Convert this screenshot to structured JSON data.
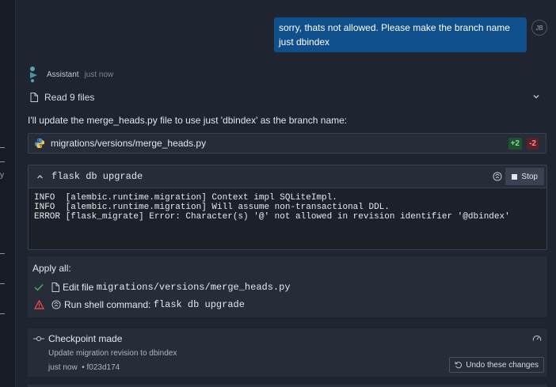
{
  "user_message": {
    "text": "sorry, thats not allowed. Please make the branch name just dbindex",
    "avatar_initials": "JB"
  },
  "assistant": {
    "name": "Assistant",
    "time": "just now",
    "read_files_label": "Read 9 files",
    "intro": "I'll update the merge_heads.py file to use just 'dbindex' as the branch name:"
  },
  "file_card": {
    "path": "migrations/versions/merge_heads.py",
    "additions": "+2",
    "deletions": "-2"
  },
  "terminal": {
    "command": "flask db upgrade",
    "stop_label": "Stop",
    "output": [
      "INFO  [alembic.runtime.migration] Context impl SQLiteImpl.",
      "INFO  [alembic.runtime.migration] Will assume non-transactional DDL.",
      "ERROR [flask_migrate] Error: Character(s) '@' not allowed in revision identifier '@dbindex'"
    ]
  },
  "apply_all": {
    "title": "Apply all:",
    "items": [
      {
        "status": "success",
        "prefix": "Edit file ",
        "target": "migrations/versions/merge_heads.py"
      },
      {
        "status": "warning",
        "prefix": "Run shell command: ",
        "target": "flask db upgrade"
      }
    ]
  },
  "checkpoint": {
    "title": "Checkpoint made",
    "description": "Update migration revision to dbindex",
    "time": "just now",
    "hash": "f023d174",
    "undo_label": "Undo these changes"
  },
  "colors": {
    "background": "#1e2430",
    "user_bubble": "#0f4f8b",
    "success": "#3fb950",
    "warning": "#f85149",
    "addition": "#7ee08a",
    "deletion": "#ff8a8a"
  },
  "icons": [
    "assistant-logo-icon",
    "file-icon",
    "chevron-down-icon",
    "python-icon",
    "chevron-up-icon",
    "shell-icon",
    "stop-icon",
    "check-icon",
    "warning-icon",
    "commit-icon",
    "gauge-icon",
    "undo-icon"
  ]
}
